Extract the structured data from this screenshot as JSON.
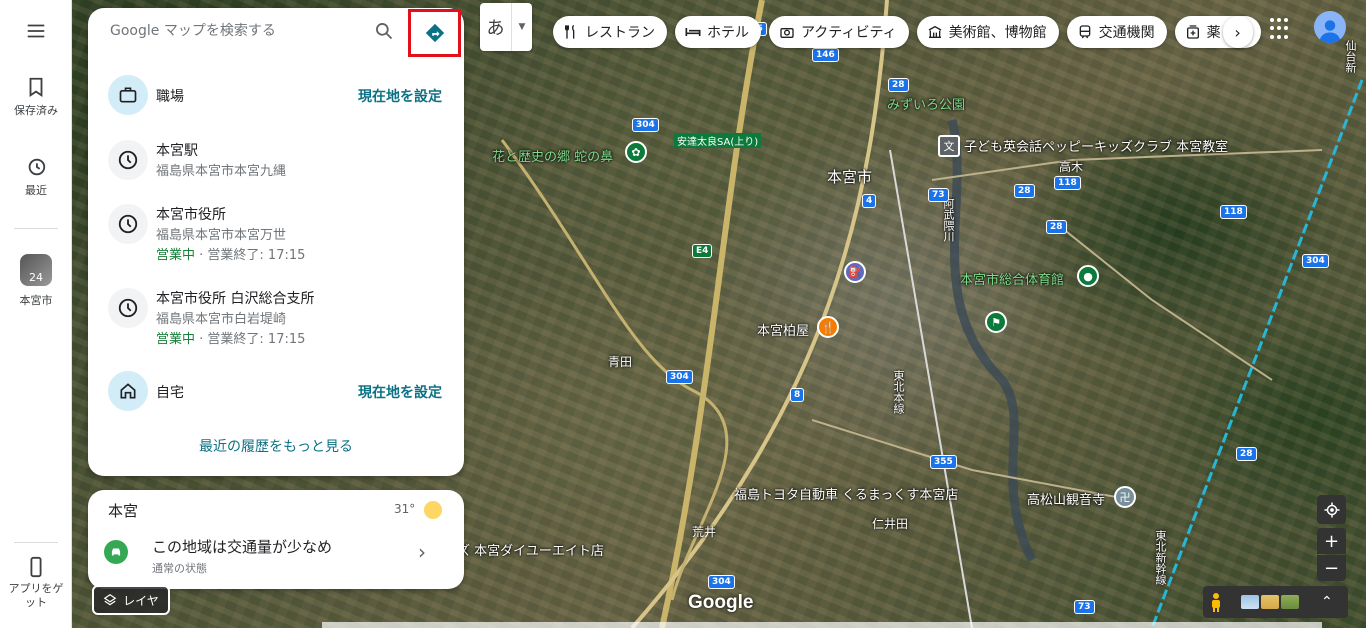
{
  "rail": {
    "menu_icon": "menu-icon",
    "saved_label": "保存済み",
    "recent_label": "最近",
    "recent_place_label": "本宮市",
    "recent_place_badge": "24",
    "get_app_label": "アプリをゲット"
  },
  "search": {
    "placeholder": "Google マップを検索する"
  },
  "list": [
    {
      "title": "職場",
      "action": "現在地を設定",
      "icon": "briefcase-icon"
    },
    {
      "title": "本宮駅",
      "subtitle": "福島県本宮市本宮九縄",
      "icon": "history-icon"
    },
    {
      "title": "本宮市役所",
      "subtitle": "福島県本宮市本宮万世",
      "status_open": "営業中",
      "status_rest": " · 営業終了: 17:15",
      "icon": "history-icon"
    },
    {
      "title": "本宮市役所 白沢総合支所",
      "subtitle": "福島県本宮市白岩堤崎",
      "status_open": "営業中",
      "status_rest": " · 営業終了: 17:15",
      "icon": "history-icon"
    },
    {
      "title": "自宅",
      "action": "現在地を設定",
      "icon": "home-icon"
    }
  ],
  "more_history": "最近の履歴をもっと見る",
  "card": {
    "place": "本宮",
    "temperature": "31°",
    "traffic_title": "この地域は交通量が少なめ",
    "traffic_sub": "通常の状態"
  },
  "layers_label": "レイヤ",
  "ime_char": "あ",
  "chips": [
    {
      "label": "レストラン",
      "icon": "restaurant-icon"
    },
    {
      "label": "ホテル",
      "icon": "hotel-icon"
    },
    {
      "label": "アクティビティ",
      "icon": "camera-icon"
    },
    {
      "label": "美術館、博物館",
      "icon": "museum-icon"
    },
    {
      "label": "交通機関",
      "icon": "transit-icon"
    },
    {
      "label": "薬",
      "icon": "pharmacy-icon"
    }
  ],
  "map": {
    "labels": {
      "motomiya_city": "本宮市",
      "flower_history": "花と歴史の郷 蛇の鼻",
      "adachi_sa": "安達太良SA(上り)",
      "miyairo_park": "みずいろ公園",
      "kids_club": "子ども英会話ペッピーキッズクラブ 本宮教室",
      "takagi": "高木",
      "gym": "本宮市総合体育館",
      "kashiwaya": "本宮柏屋",
      "aota": "青田",
      "toyota": "福島トヨタ自動車 くるまっくす本宮店",
      "nihonmatsu": "仁井田",
      "arai": "荒井",
      "takamatsuyama": "高松山観音寺",
      "daiyu": "ズ 本宮ダイユーエイト店",
      "abukuma": "阿武隈川",
      "tohoku_line": "東北本線",
      "tohoku_shinkansen": "東北新幹線",
      "ou_line": "仙台新"
    },
    "shields": [
      "146",
      "146",
      "28",
      "304",
      "73",
      "28",
      "118",
      "28",
      "118",
      "4",
      "E4",
      "304",
      "8",
      "355",
      "304",
      "28",
      "73",
      "304"
    ],
    "google_logo": "Google"
  },
  "colors": {
    "accent": "#0b7285",
    "highlight_border": "#e3101b",
    "open_status": "#188038",
    "route_shield": "#1a73e8"
  }
}
